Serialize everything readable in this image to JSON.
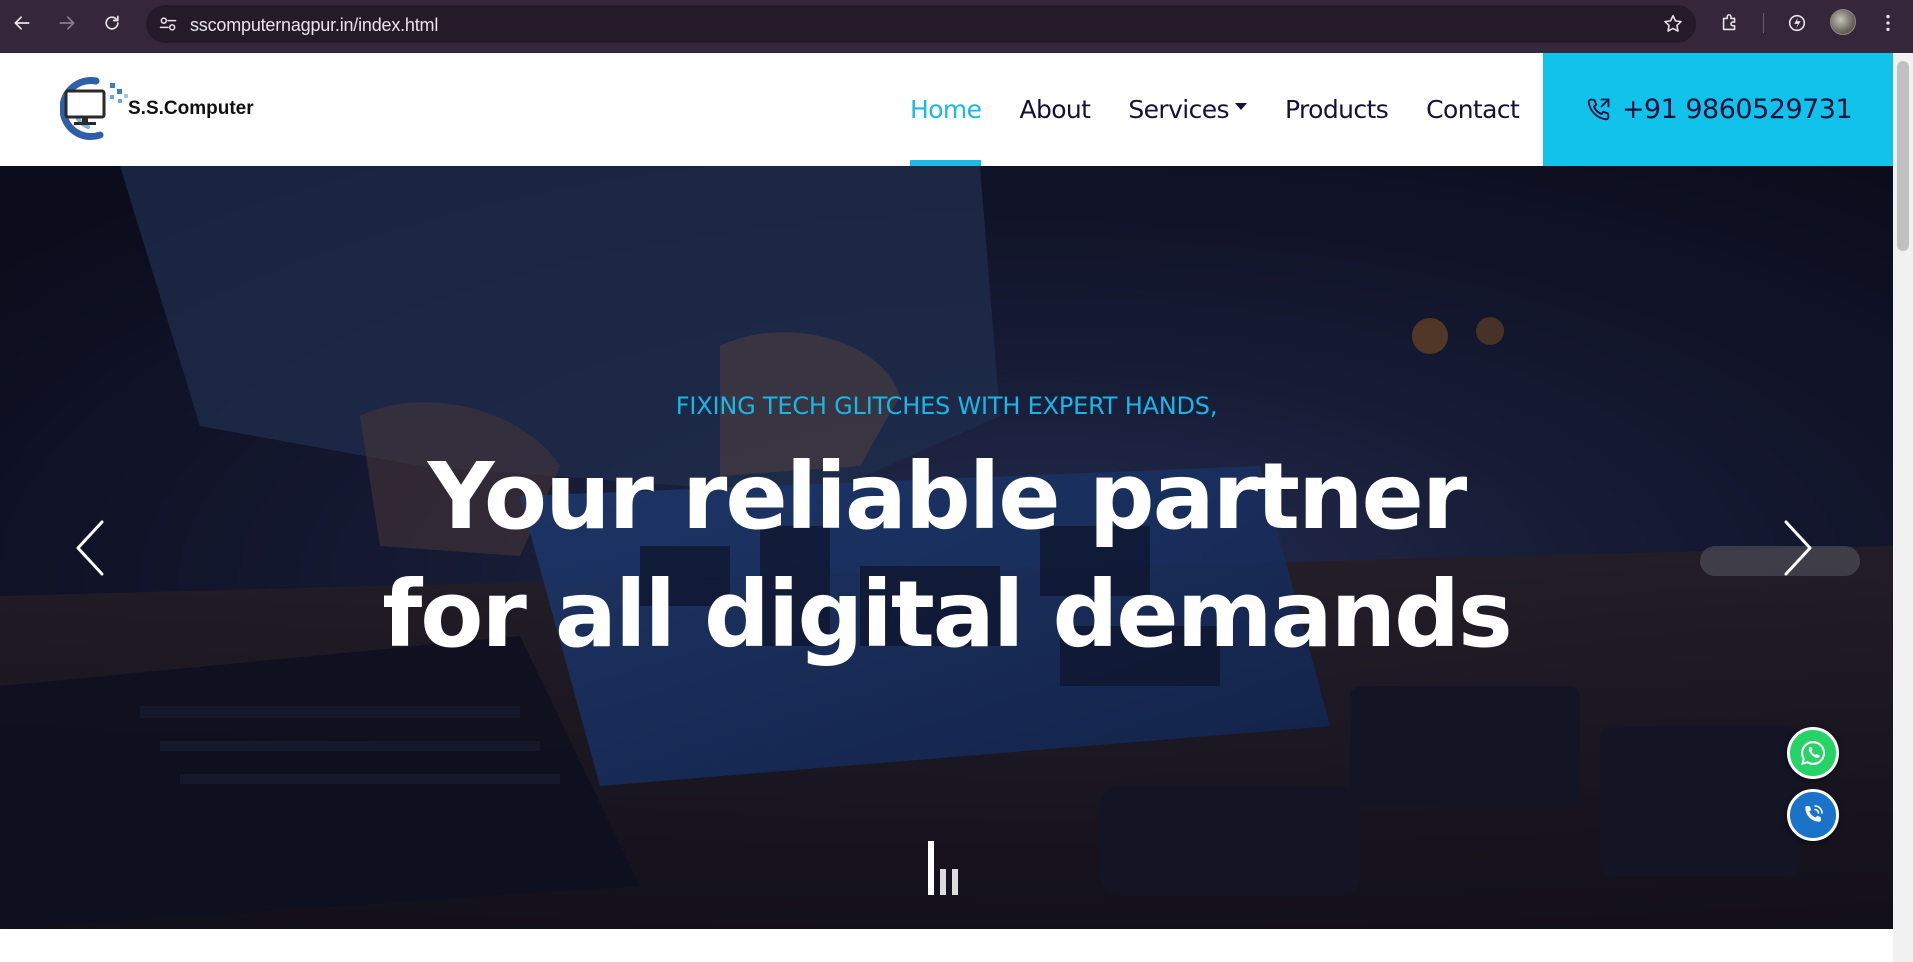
{
  "browser": {
    "url": "sscomputernagpur.in/index.html"
  },
  "site": {
    "logo_text": "S.S.Computer",
    "nav": [
      {
        "label": "Home",
        "active": true
      },
      {
        "label": "About",
        "active": false
      },
      {
        "label": "Services",
        "active": false,
        "has_dropdown": true
      },
      {
        "label": "Products",
        "active": false
      },
      {
        "label": "Contact",
        "active": false
      }
    ],
    "phone": "+91 9860529731"
  },
  "hero": {
    "kicker": "FIXING TECH GLITCHES WITH EXPERT HANDS,",
    "headline_line1": "Your reliable partner",
    "headline_line2": "for all digital demands"
  },
  "floating_buttons": [
    {
      "icon": "whatsapp-icon",
      "color": "#25d366"
    },
    {
      "icon": "phone-icon",
      "color": "#1a73c8"
    }
  ],
  "colors": {
    "accent": "#11c3ea",
    "nav_text": "#15103a",
    "chrome_bg": "#35263a"
  }
}
